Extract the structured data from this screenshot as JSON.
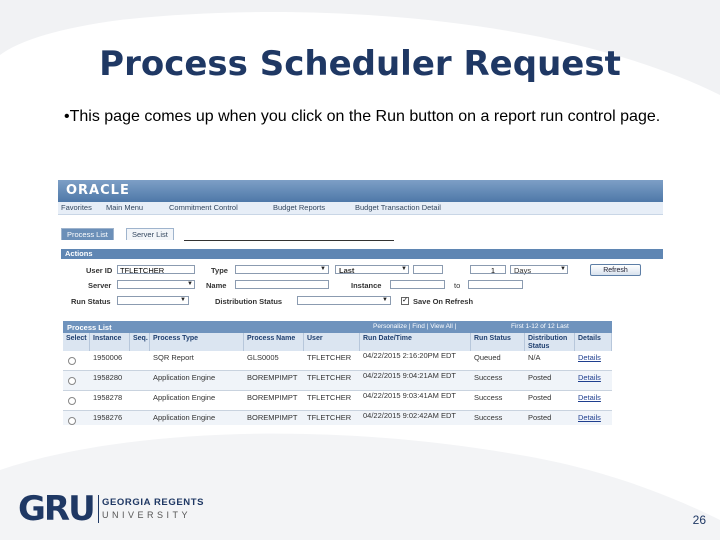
{
  "slide": {
    "title": "Process Scheduler Request",
    "bullet": "•This page comes up when you click on the Run button on a report run control page.",
    "page_number": "26"
  },
  "logo": {
    "mark": "GRU",
    "line1": "GEORGIA REGENTS",
    "line2": "UNIVERSITY"
  },
  "screenshot": {
    "brand": "ORACLE",
    "nav": [
      "Favorites",
      "Main Menu",
      "Commitment Control",
      "Budget Reports",
      "Budget Transaction Detail"
    ],
    "tabs": [
      "Process List",
      "Server List"
    ],
    "actions_title": "Actions",
    "form": {
      "user_id_label": "User ID",
      "user_id_value": "TFLETCHER",
      "type_label": "Type",
      "last_label": "Last",
      "last_count": "1",
      "days_label": "Days",
      "refresh_button": "Refresh",
      "server_label": "Server",
      "name_label": "Name",
      "instance_label": "Instance",
      "to_label": "to",
      "run_status_label": "Run Status",
      "distribution_status_label": "Distribution Status",
      "save_on_refresh_label": "Save On Refresh"
    },
    "grid": {
      "title": "Process List",
      "navigation": "Personalize | Find | View All |",
      "paging": "First 1-12 of 12 Last",
      "columns": [
        "Select",
        "Instance",
        "Seq.",
        "Process Type",
        "Process Name",
        "User",
        "Run Date/Time",
        "Run Status",
        "Distribution Status",
        "Details"
      ],
      "rows": [
        {
          "instance": "1950006",
          "seq": "",
          "type": "SQR Report",
          "name": "GLS0005",
          "user": "TFLETCHER",
          "datetime": "04/22/2015 2:16:20PM EDT",
          "status": "Queued",
          "distribution": "N/A",
          "details": "Details"
        },
        {
          "instance": "1958280",
          "seq": "",
          "type": "Application Engine",
          "name": "BOREMPIMPT",
          "user": "TFLETCHER",
          "datetime": "04/22/2015 9:04:21AM EDT",
          "status": "Success",
          "distribution": "Posted",
          "details": "Details"
        },
        {
          "instance": "1958278",
          "seq": "",
          "type": "Application Engine",
          "name": "BOREMPIMPT",
          "user": "TFLETCHER",
          "datetime": "04/22/2015 9:03:41AM EDT",
          "status": "Success",
          "distribution": "Posted",
          "details": "Details"
        },
        {
          "instance": "1958276",
          "seq": "",
          "type": "Application Engine",
          "name": "BOREMPIMPT",
          "user": "TFLETCHER",
          "datetime": "04/22/2015 9:02:42AM EDT",
          "status": "Success",
          "distribution": "Posted",
          "details": "Details"
        }
      ]
    }
  },
  "colors": {
    "title": "#1f3864",
    "header_bar": "#5f86b3",
    "accent_gray": "#eef0f3"
  }
}
